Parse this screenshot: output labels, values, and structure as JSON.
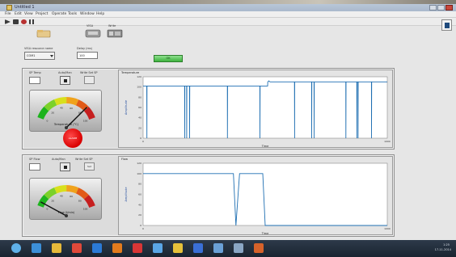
{
  "colors": {
    "window_bg": "#e6e6e6",
    "panel_bg": "#dcdcdc",
    "plot_bg": "#ffffff",
    "plot_line": "#1f6fb2",
    "ok_button": "#4bbf4b",
    "alarm": "#e00000",
    "taskbar": "#1f2935"
  },
  "window": {
    "title": "Untitled 1",
    "menu": [
      "File",
      "Edit",
      "View",
      "Project",
      "Operate",
      "Tools",
      "Window",
      "Help"
    ]
  },
  "toolbar": {
    "icons": [
      "run-arrow-icon",
      "run-continuous-icon",
      "abort-icon",
      "pause-icon"
    ]
  },
  "controls": {
    "icon1": {
      "label": ""
    },
    "icon2": {
      "label": "VISA"
    },
    "icon3": {
      "label": "Write"
    },
    "resource": {
      "label": "VISA resource name",
      "value": "COM1"
    },
    "delay": {
      "label": "Delay (ms)",
      "value": "100"
    },
    "ok_label": "OK"
  },
  "panel1": {
    "sp_label": "SP Temp",
    "sp_value": "",
    "toggle_label": "Auto/Man",
    "btn_label": "Write Set SP",
    "btn_text": "",
    "gauge_label": "Temperature (°C)",
    "gauge_ticks": [
      "0",
      "20",
      "40",
      "60",
      "80",
      "100"
    ],
    "alarm_label": "ALARM",
    "gauge_value": 0.82
  },
  "panel2": {
    "sp_label": "SP Flow",
    "sp_value": "",
    "toggle_label": "Auto/Man",
    "btn_label": "Write Set SP",
    "btn_text": "Set",
    "gauge_label": "Flow (l/min)",
    "gauge_ticks": [
      "0",
      "20",
      "40",
      "60",
      "80",
      "100"
    ],
    "gauge_value": 0.06
  },
  "taskbar": {
    "time": "1:25",
    "date": "17-11-2014",
    "apps": [
      "start",
      "ie",
      "explorer",
      "chrome",
      "media",
      "office",
      "opera",
      "file",
      "labview",
      "app",
      "pc",
      "vi",
      "ppt"
    ]
  },
  "chart_data": [
    {
      "type": "line",
      "title": "Temperature",
      "xlabel": "Time",
      "ylabel": "Amplitude",
      "xlim": [
        0,
        1000
      ],
      "ylim": [
        0,
        120
      ],
      "x_ticks": [
        "0",
        "1000"
      ],
      "y_ticks": [
        "0",
        "20",
        "40",
        "60",
        "80",
        "100",
        "120"
      ],
      "x": [
        0,
        15,
        15.5,
        16,
        170,
        170.5,
        171,
        178,
        178.5,
        179,
        190,
        190.5,
        191,
        345,
        345.5,
        346,
        478,
        478.5,
        479,
        510,
        510.5,
        515,
        520,
        620,
        620.5,
        621,
        690,
        690.5,
        691,
        700,
        700.5,
        701,
        830,
        830.5,
        831,
        875,
        875.5,
        876,
        880,
        880.5,
        881,
        935,
        935.5,
        936,
        1000
      ],
      "y": [
        102,
        102,
        0,
        102,
        102,
        0,
        102,
        102,
        0,
        102,
        102,
        0,
        102,
        102,
        0,
        102,
        102,
        0,
        102,
        102,
        110,
        112,
        110,
        110,
        0,
        110,
        110,
        0,
        110,
        110,
        0,
        110,
        110,
        0,
        110,
        110,
        0,
        110,
        110,
        0,
        110,
        110,
        0,
        110,
        110
      ]
    },
    {
      "type": "line",
      "title": "Flow",
      "xlabel": "Time",
      "ylabel": "Amplitude",
      "xlim": [
        0,
        1000
      ],
      "ylim": [
        0,
        120
      ],
      "x_ticks": [
        "0",
        "1000"
      ],
      "y_ticks": [
        "0",
        "20",
        "40",
        "60",
        "80",
        "100",
        "120"
      ],
      "x": [
        0,
        370,
        380,
        395,
        410,
        490,
        500,
        1000
      ],
      "y": [
        100,
        100,
        0,
        100,
        100,
        100,
        0,
        0
      ]
    }
  ]
}
